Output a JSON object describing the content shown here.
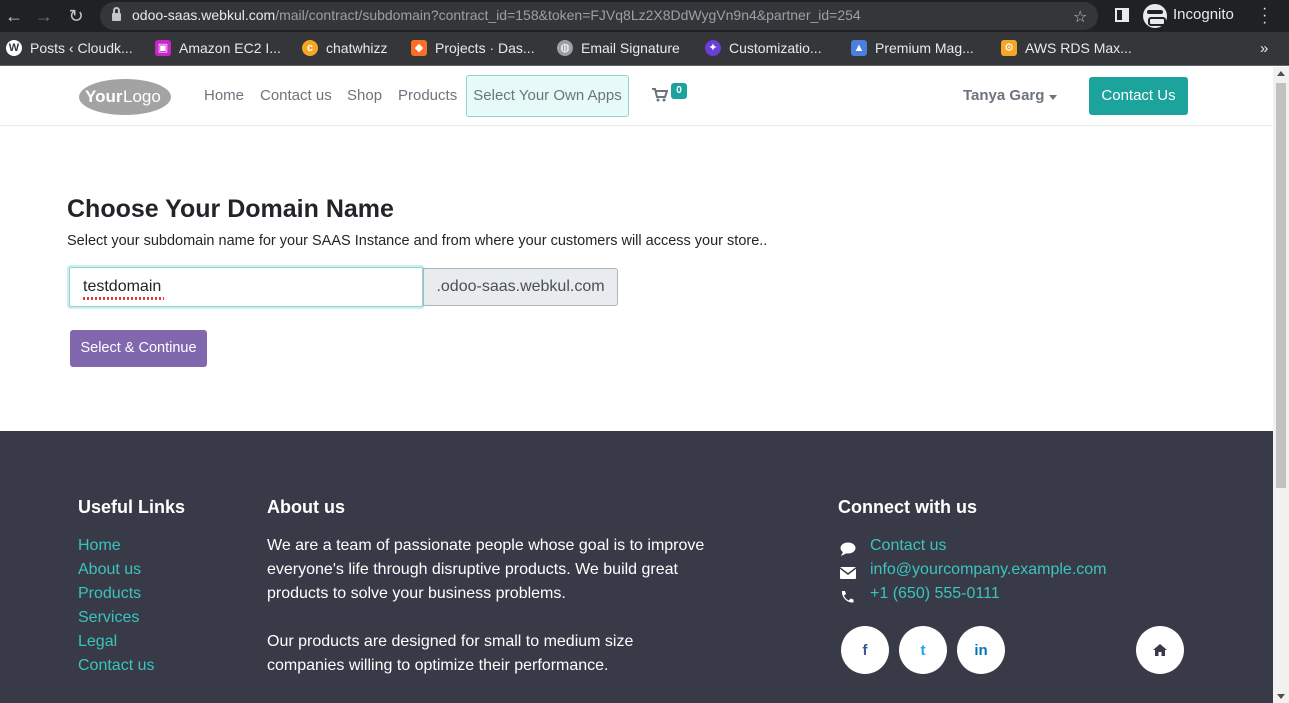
{
  "browser": {
    "url_host": "odoo-saas.webkul.com",
    "url_path": "/mail/contract/subdomain?contract_id=158&token=FJVq8Lz2X8DdWygVn9n4&partner_id=254",
    "profile_label": "Incognito",
    "bookmarks": [
      {
        "label": "Posts ‹ Cloudk...",
        "icon": "wordpress-icon",
        "color": "#ffffff"
      },
      {
        "label": "Amazon EC2 I...",
        "icon": "amazon-ec2-icon",
        "color": "#c925c9"
      },
      {
        "label": "chatwhizz",
        "icon": "chatwhizz-icon",
        "color": "#f5a623"
      },
      {
        "label": "Projects · Das...",
        "icon": "gitlab-icon",
        "color": "#fc6d26"
      },
      {
        "label": "Email Signature",
        "icon": "globe-icon",
        "color": "#9aa0a6"
      },
      {
        "label": "Customizatio...",
        "icon": "customization-icon",
        "color": "#6a3fd8"
      },
      {
        "label": "Premium Mag...",
        "icon": "premium-icon",
        "color": "#4a7fe0"
      },
      {
        "label": "AWS RDS Max...",
        "icon": "aws-rds-icon",
        "color": "#f5a623"
      }
    ]
  },
  "header": {
    "logo_text_your": "Your",
    "logo_text_logo": "Logo",
    "nav": [
      "Home",
      "Contact us",
      "Shop",
      "Products"
    ],
    "nav_highlight": "Select Your Own Apps",
    "cart_count": "0",
    "user_name": "Tanya Garg",
    "contact_button": "Contact Us"
  },
  "main": {
    "title": "Choose Your Domain Name",
    "description": "Select your subdomain name for your SAAS Instance and from where your customers will access your store..",
    "subdomain_value": "testdomain",
    "domain_suffix": ".odoo-saas.webkul.com",
    "continue_button": "Select & Continue"
  },
  "footer": {
    "useful_links_title": "Useful Links",
    "useful_links": [
      "Home",
      "About us",
      "Products",
      "Services",
      "Legal",
      "Contact us"
    ],
    "about_title": "About us",
    "about_lines_1": [
      "We are a team of passionate people whose goal is to improve",
      "everyone's life through disruptive products. We build great",
      "products to solve your business problems."
    ],
    "about_lines_2": [
      "Our products are designed for small to medium size",
      "companies willing to optimize their performance."
    ],
    "connect_title": "Connect with us",
    "connect_contact": "Contact us",
    "connect_email": "info@yourcompany.example.com",
    "connect_phone": "+1 (650) 555-0111",
    "social": {
      "facebook": "f",
      "twitter": "t",
      "linkedin": "in"
    }
  },
  "colors": {
    "accent": "#1ba39c",
    "primary_button": "#8067ae",
    "footer_bg": "#383b47",
    "footer_link": "#3bc3bd"
  }
}
